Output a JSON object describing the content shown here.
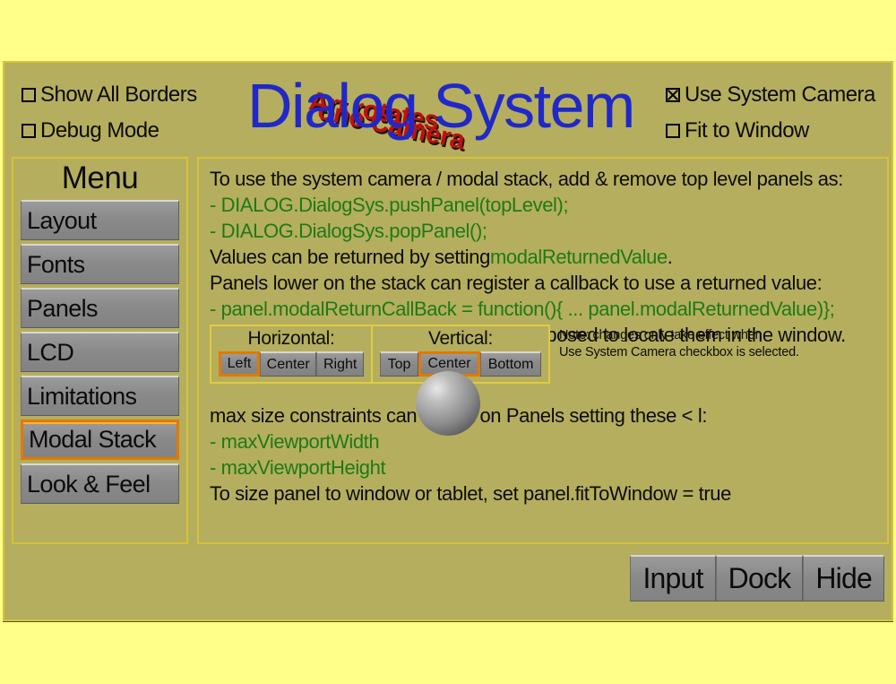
{
  "window": {
    "title": "Dialog System",
    "overlay_lines": [
      "Art rotates",
      "one Camera"
    ]
  },
  "header": {
    "left_checkboxes": [
      {
        "label": "Show All Borders",
        "checked": false
      },
      {
        "label": "Debug Mode",
        "checked": false
      }
    ],
    "right_checkboxes": [
      {
        "label": "Use System Camera",
        "checked": true
      },
      {
        "label": "Fit to Window",
        "checked": false
      }
    ]
  },
  "sidebar": {
    "title": "Menu",
    "items": [
      {
        "label": "Layout",
        "selected": false
      },
      {
        "label": "Fonts",
        "selected": false
      },
      {
        "label": "Panels",
        "selected": false
      },
      {
        "label": "LCD",
        "selected": false
      },
      {
        "label": "Limitations",
        "selected": false
      },
      {
        "label": "Modal Stack",
        "selected": true
      },
      {
        "label": "Look & Feel",
        "selected": false
      }
    ]
  },
  "content": {
    "line_1": "To use the system camera / modal stack, add & remove top level panels as:",
    "line_2": "- DIALOG.DialogSys.pushPanel(topLevel);",
    "line_3": "- DIALOG.DialogSys.popPanel();",
    "line_4_a": "Values can be returned by setting",
    "line_4_b": "modalReturnedValue",
    "line_4_c": ".",
    "line_5": "Panels lower on the stack can register a callback to use a returned value:",
    "line_6": "- panel.modalReturnCallBack = function(){ ... panel.modalReturnedValue)};",
    "line_7": "Alignment properties of Panel are re-purposed to locate them in the window.",
    "line_8": "max size constraints can be put on Panels setting these < l:",
    "line_9": "- maxViewportWidth",
    "line_10": "- maxViewportHeight",
    "line_11": "To size panel to window or tablet, set panel.fitToWindow = true"
  },
  "alignment": {
    "horizontal": {
      "title": "Horizontal:",
      "options": [
        {
          "label": "Left",
          "selected": true
        },
        {
          "label": "Center",
          "selected": false
        },
        {
          "label": "Right",
          "selected": false
        }
      ]
    },
    "vertical": {
      "title": "Vertical:",
      "options": [
        {
          "label": "Top",
          "selected": false
        },
        {
          "label": "Center",
          "selected": true
        },
        {
          "label": "Bottom",
          "selected": false
        }
      ]
    },
    "note_line_1": "Note: changes only take effect when",
    "note_line_2": "Use System Camera checkbox is selected."
  },
  "footer": {
    "buttons": [
      {
        "label": "Input"
      },
      {
        "label": "Dock"
      },
      {
        "label": "Hide"
      }
    ]
  },
  "colors": {
    "page_background": "#ffff8a",
    "panel_background": "#b5ae5e",
    "panel_border": "#d6c23a",
    "title_blue": "#2028c8",
    "overlay_red": "#c01010",
    "code_green": "#1e7a16",
    "selected_orange": "#e07a00",
    "button_grey": "#8a8a8a"
  }
}
